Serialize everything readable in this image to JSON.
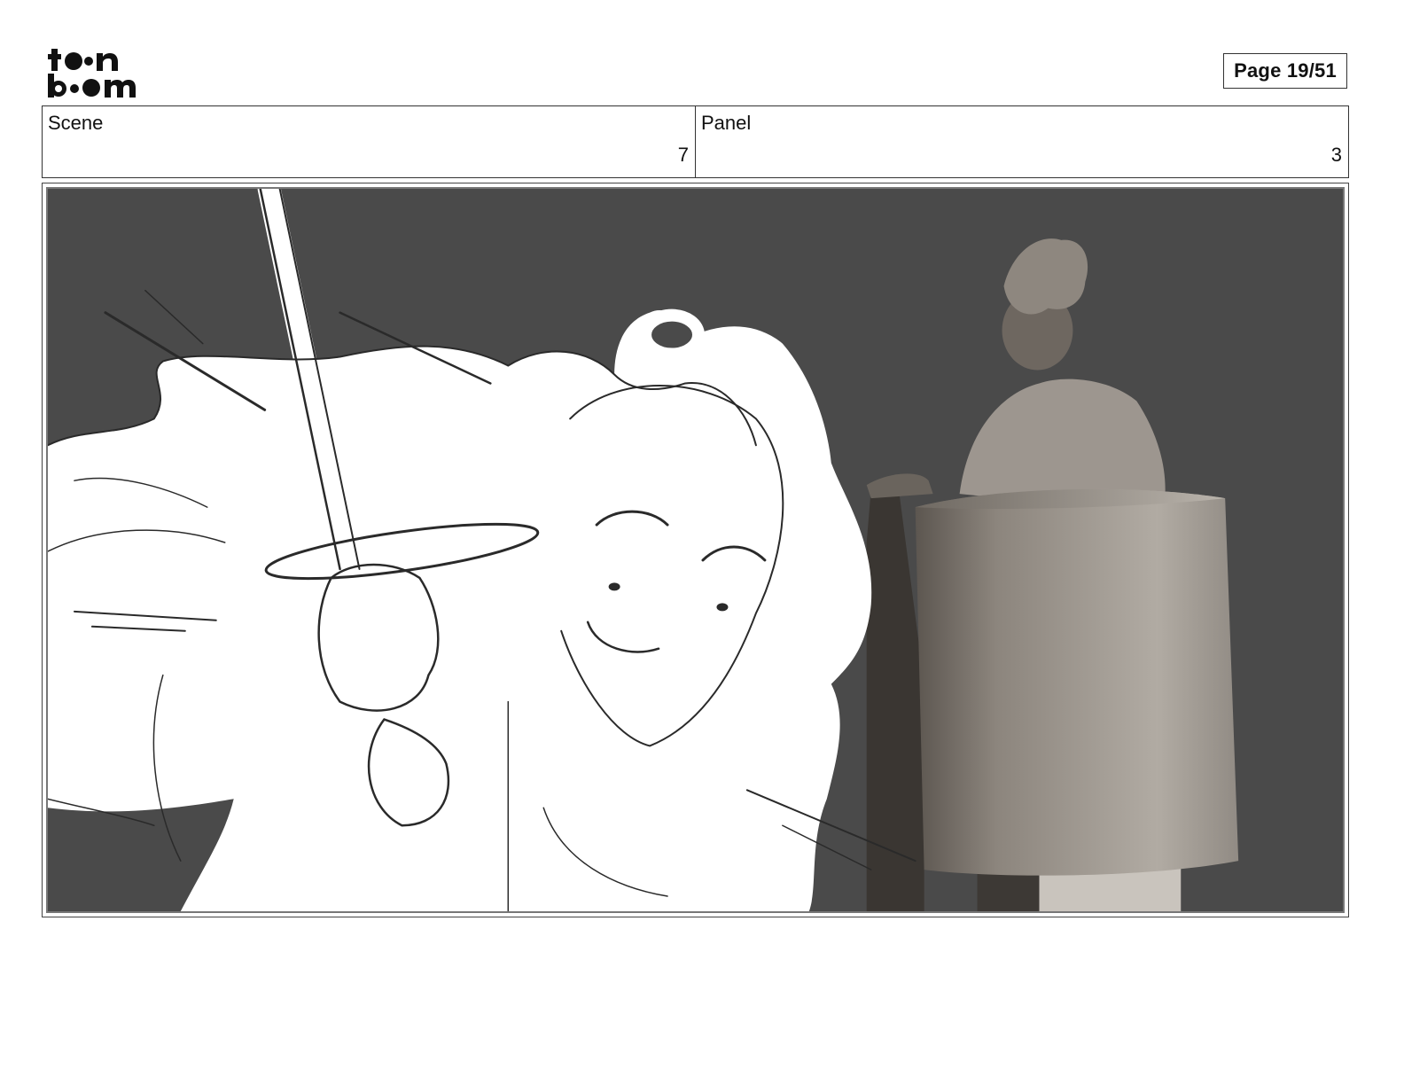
{
  "header": {
    "logo_text": "toon boom",
    "page_label": "Page 19/51"
  },
  "info": {
    "scene_label": "Scene",
    "scene_value": "7",
    "panel_label": "Panel",
    "panel_value": "3"
  },
  "panel": {
    "background_color": "#4a4a4a",
    "sketch_color": "#ffffff",
    "statue_color": "#a49e97"
  }
}
